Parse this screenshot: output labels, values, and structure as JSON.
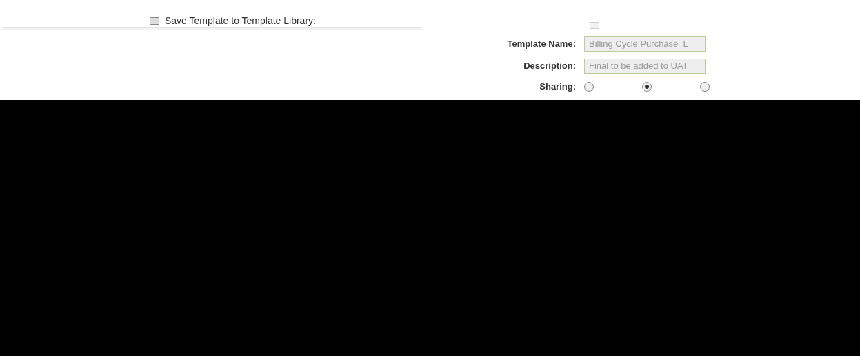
{
  "save_template": {
    "label": "Save Template to Template Library:",
    "checked": false
  },
  "second_checkbox": {
    "checked": false
  },
  "template_name": {
    "label": "Template Name:",
    "value": "Billing Cycle Purchase  L"
  },
  "description": {
    "label": "Description:",
    "value": "Final to be added to UAT"
  },
  "sharing": {
    "label": "Sharing:",
    "options": [
      {
        "selected": false
      },
      {
        "selected": true
      },
      {
        "selected": false
      }
    ]
  }
}
